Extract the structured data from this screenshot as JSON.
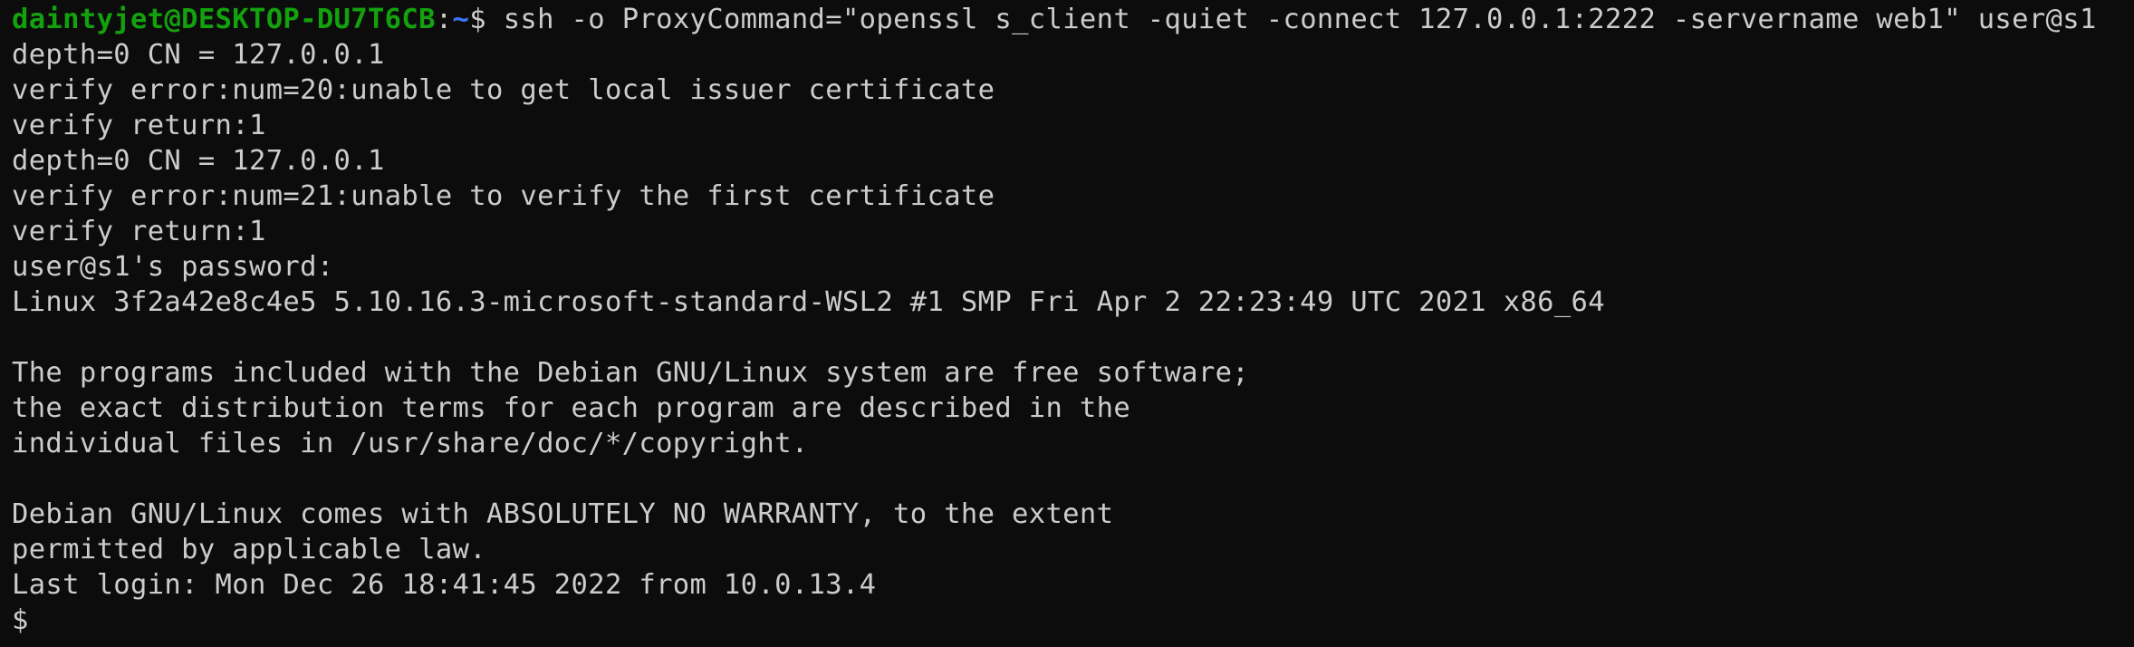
{
  "prompt": {
    "user_host": "daintyjet@DESKTOP-DU7T6CB",
    "colon": ":",
    "path": "~",
    "dollar": "$ ",
    "command": "ssh -o ProxyCommand=\"openssl s_client -quiet -connect 127.0.0.1:2222 -servername web1\" user@s1"
  },
  "output": [
    "depth=0 CN = 127.0.0.1",
    "verify error:num=20:unable to get local issuer certificate",
    "verify return:1",
    "depth=0 CN = 127.0.0.1",
    "verify error:num=21:unable to verify the first certificate",
    "verify return:1",
    "user@s1's password:",
    "Linux 3f2a42e8c4e5 5.10.16.3-microsoft-standard-WSL2 #1 SMP Fri Apr 2 22:23:49 UTC 2021 x86_64",
    "",
    "The programs included with the Debian GNU/Linux system are free software;",
    "the exact distribution terms for each program are described in the",
    "individual files in /usr/share/doc/*/copyright.",
    "",
    "Debian GNU/Linux comes with ABSOLUTELY NO WARRANTY, to the extent",
    "permitted by applicable law.",
    "Last login: Mon Dec 26 18:41:45 2022 from 10.0.13.4"
  ],
  "remote_prompt": "$",
  "colors": {
    "background": "#0c0c0c",
    "foreground": "#cccccc",
    "prompt_user": "#13a10e",
    "prompt_path": "#3b78ff"
  }
}
